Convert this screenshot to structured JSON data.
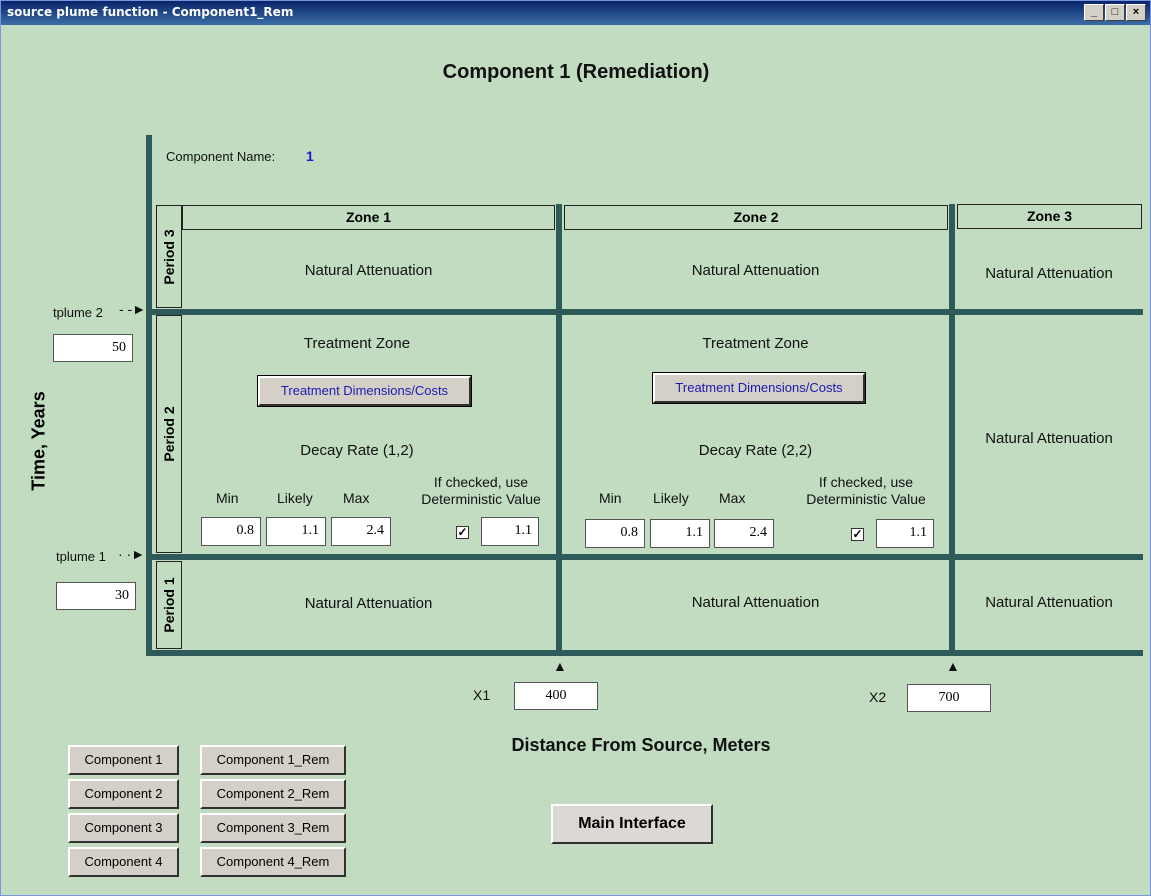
{
  "window": {
    "title": "source plume  function - Component1_Rem",
    "minimize": "_",
    "maximize": "□",
    "close": "×"
  },
  "heading": "Component 1 (Remediation)",
  "component_name": {
    "label": "Component Name:",
    "value": "1"
  },
  "y_axis_label": "Time, Years",
  "x_axis_label": "Distance From Source, Meters",
  "zones": [
    "Zone 1",
    "Zone 2",
    "Zone 3"
  ],
  "periods": [
    "Period 3",
    "Period 2",
    "Period 1"
  ],
  "tplume2": {
    "label": "tplume 2",
    "value": "50"
  },
  "tplume1": {
    "label": "tplume 1",
    "value": "30"
  },
  "x1": {
    "label": "X1",
    "value": "400"
  },
  "x2": {
    "label": "X2",
    "value": "700"
  },
  "cells": {
    "p3z1": "Natural Attenuation",
    "p3z2": "Natural Attenuation",
    "p3z3": "Natural Attenuation",
    "p2z3": "Natural Attenuation",
    "p1z1": "Natural Attenuation",
    "p1z2": "Natural Attenuation",
    "p1z3": "Natural Attenuation"
  },
  "zone1_treatment": {
    "title": "Treatment Zone",
    "button": "Treatment Dimensions/Costs",
    "decay_label": "Decay Rate (1,2)",
    "min_label": "Min",
    "likely_label": "Likely",
    "max_label": "Max",
    "det_label_1": "If checked, use",
    "det_label_2": "Deterministic Value",
    "min": "0.8",
    "likely": "1.1",
    "max": "2.4",
    "checked": true,
    "det_value": "1.1"
  },
  "zone2_treatment": {
    "title": "Treatment Zone",
    "button": "Treatment Dimensions/Costs",
    "decay_label": "Decay Rate (2,2)",
    "min_label": "Min",
    "likely_label": "Likely",
    "max_label": "Max",
    "det_label_1": "If checked, use",
    "det_label_2": "Deterministic Value",
    "min": "0.8",
    "likely": "1.1",
    "max": "2.4",
    "checked": true,
    "det_value": "1.1"
  },
  "component_buttons": [
    "Component 1",
    "Component 2",
    "Component 3",
    "Component 4"
  ],
  "rem_buttons": [
    "Component 1_Rem",
    "Component 2_Rem",
    "Component 3_Rem",
    "Component 4_Rem"
  ],
  "main_button": "Main Interface",
  "check_mark": "✓",
  "colors": {
    "background": "#c2dcc2",
    "grid_bar": "#2e5a5a",
    "component_name_value": "#1a1ad0",
    "button_text_blue": "#1a1ab0"
  }
}
